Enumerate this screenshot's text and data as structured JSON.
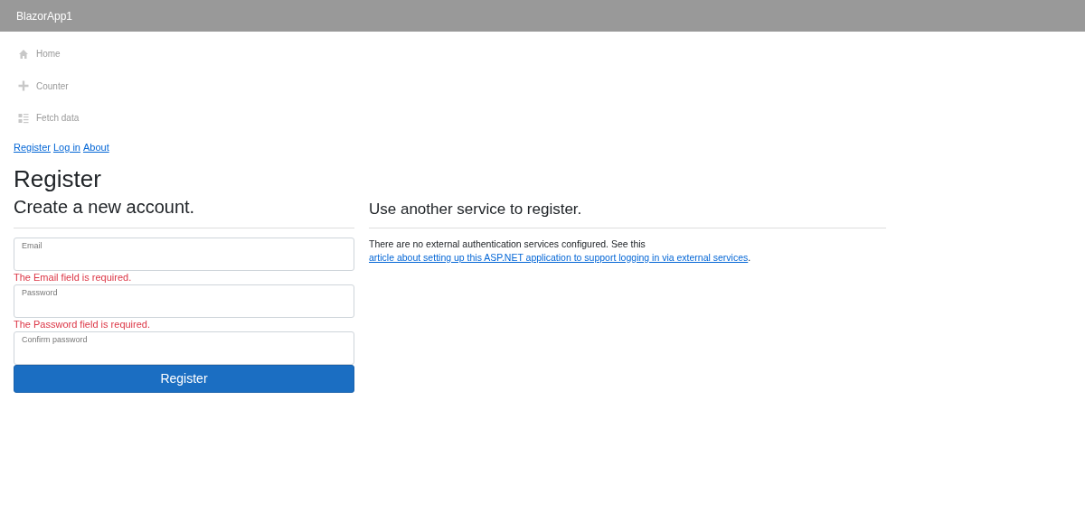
{
  "header": {
    "title": "BlazorApp1"
  },
  "nav": [
    {
      "label": "Home",
      "kind": "home",
      "disabled": true
    },
    {
      "label": "Counter",
      "kind": "counter",
      "disabled": true
    },
    {
      "label": "Fetch data",
      "kind": "data",
      "disabled": true
    }
  ],
  "links": [
    "Register",
    "Log in",
    "About"
  ],
  "page_title": "Register",
  "form": {
    "heading": "Create a new account.",
    "fields": [
      {
        "placeholder": "Email",
        "error": "The Email field is required."
      },
      {
        "placeholder": "Password",
        "error": "The Password field is required."
      },
      {
        "placeholder": "Confirm password"
      }
    ],
    "submit": "Register"
  },
  "external": {
    "heading": "Use another service to register.",
    "text": "There are no external authentication services configured. See this",
    "link": "article about setting up this ASP.NET application to support logging in via external services",
    "after": "."
  }
}
